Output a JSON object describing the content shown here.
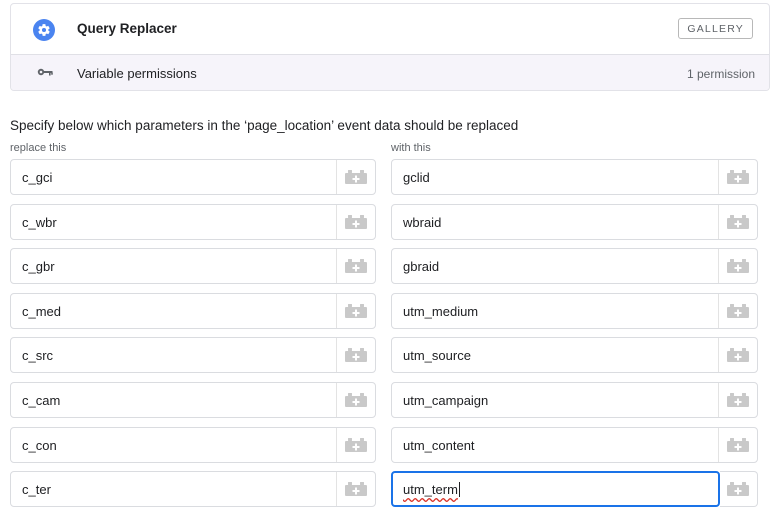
{
  "template": {
    "name": "Query Replacer",
    "gallery_label": "GALLERY",
    "permissions_label": "Variable permissions",
    "permissions_count": "1 permission",
    "icon": "gear-icon",
    "permissions_icon": "key-icon"
  },
  "form": {
    "description": "Specify below which parameters in the ‘page_location’ event data should be replaced",
    "left_column_label": "replace this",
    "right_column_label": "with this",
    "add_variable_icon": "lego-brick-plus-icon",
    "rows": [
      {
        "replace": "c_gci",
        "with": "gclid"
      },
      {
        "replace": "c_wbr",
        "with": "wbraid"
      },
      {
        "replace": "c_gbr",
        "with": "gbraid"
      },
      {
        "replace": "c_med",
        "with": "utm_medium"
      },
      {
        "replace": "c_src",
        "with": "utm_source"
      },
      {
        "replace": "c_cam",
        "with": "utm_campaign"
      },
      {
        "replace": "c_con",
        "with": "utm_content"
      },
      {
        "replace": "c_ter",
        "with": "utm_term"
      }
    ]
  },
  "colors": {
    "accent_blue": "#1a73e8",
    "icon_blue": "#4a84f0",
    "brick_gray": "#c9c9c9"
  }
}
